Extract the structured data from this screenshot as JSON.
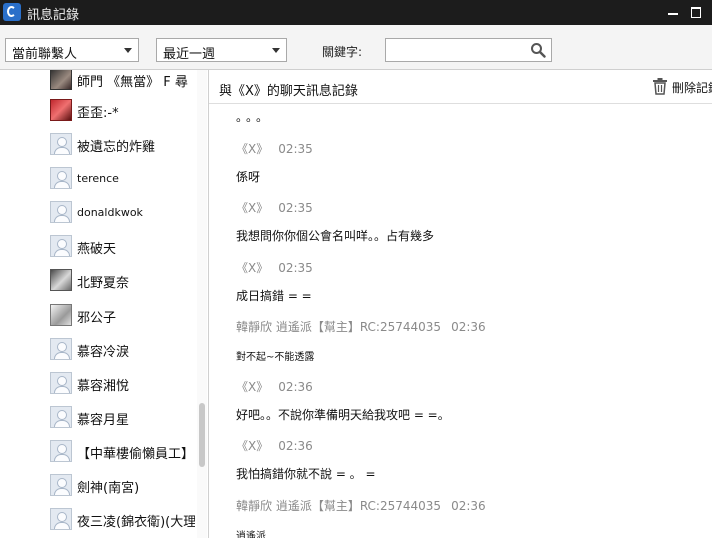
{
  "window": {
    "title": "訊息記錄"
  },
  "toolbar": {
    "contact_filter": "當前聯繫人",
    "period_filter": "最近一週",
    "keyword_label": "關鍵字:",
    "keyword_value": ""
  },
  "contacts": [
    {
      "name": "師門 《無當》 F 尋",
      "avatar": "photo-dark"
    },
    {
      "name": "歪歪:-*",
      "avatar": "photo-red"
    },
    {
      "name": "被遺忘的炸雞",
      "avatar": "default"
    },
    {
      "name": "terence",
      "avatar": "default"
    },
    {
      "name": "donaldkwok",
      "avatar": "default"
    },
    {
      "name": "燕破天",
      "avatar": "default"
    },
    {
      "name": "北野夏奈",
      "avatar": "photo-gray"
    },
    {
      "name": "邪公子",
      "avatar": "photo-sketch"
    },
    {
      "name": "慕容冷淚",
      "avatar": "default"
    },
    {
      "name": "慕容湘悅",
      "avatar": "default"
    },
    {
      "name": "慕容月星",
      "avatar": "default"
    },
    {
      "name": "【中華樓偷懶員工】",
      "avatar": "default"
    },
    {
      "name": "劍神(南宮)",
      "avatar": "default"
    },
    {
      "name": "夜三凌(錦衣衛)(大理)",
      "avatar": "default"
    }
  ],
  "chat": {
    "title": "與《X》的聊天訊息記錄",
    "delete_label": "刪除記錄",
    "leading_text": "。。。",
    "messages": [
      {
        "sender": "《X》",
        "time": "02:35",
        "text": "係呀"
      },
      {
        "sender": "《X》",
        "time": "02:35",
        "text": "我想問你你個公會名叫咩。。占有幾多"
      },
      {
        "sender": "《X》",
        "time": "02:35",
        "text": "成日搞錯 = ="
      },
      {
        "sender": "韓靜欣 逍遙派【幫主】RC:25744035",
        "time": "02:36",
        "text": "對不起~不能透露"
      },
      {
        "sender": "《X》",
        "time": "02:36",
        "text": "好吧。。不說你準備明天給我攻吧 = =。"
      },
      {
        "sender": "《X》",
        "time": "02:36",
        "text": "我怕搞錯你就不說 = 。 ="
      },
      {
        "sender": "韓靜欣 逍遙派【幫主】RC:25744035",
        "time": "02:36",
        "text": "逍遙派"
      }
    ]
  },
  "colors": {
    "titlebar": "#1c1c1c",
    "toolbar": "#f4f4f4",
    "meta_text": "#8a8a8a"
  }
}
